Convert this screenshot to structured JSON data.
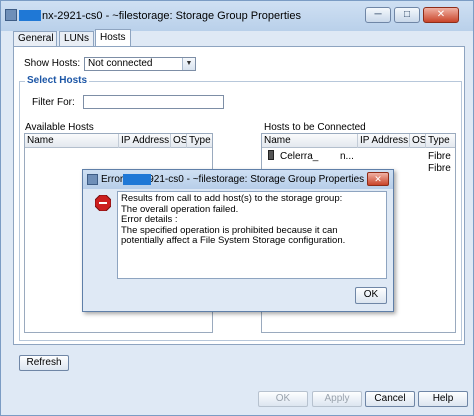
{
  "window": {
    "title": "nx-2921-cs0 - ~filestorage: Storage Group Properties",
    "minimize_glyph": "─",
    "maximize_glyph": "□",
    "close_glyph": "✕"
  },
  "tabs": [
    {
      "label": "General"
    },
    {
      "label": "LUNs"
    },
    {
      "label": "Hosts"
    }
  ],
  "show_hosts": {
    "label": "Show Hosts:",
    "selected": "Not connected"
  },
  "select_hosts": {
    "title": "Select Hosts",
    "filter_label": "Filter For:",
    "filter_value": ""
  },
  "available_hosts": {
    "label": "Available Hosts",
    "columns": [
      "Name",
      "IP Address",
      "OS",
      "Type"
    ],
    "rows": []
  },
  "connected_hosts": {
    "label": "Hosts to be Connected",
    "columns": [
      "Name",
      "IP Address",
      "OS",
      "Type"
    ],
    "rows": [
      {
        "name": "Celerra_",
        "ip": "n...",
        "type": "Fibre"
      },
      {
        "name": "",
        "ip": "",
        "type": "Fibre"
      }
    ]
  },
  "buttons": {
    "refresh": "Refresh",
    "ok": "OK",
    "apply": "Apply",
    "cancel": "Cancel",
    "help": "Help"
  },
  "error_dialog": {
    "title": "Error: nx-2921-cs0 - ~filestorage: Storage Group Properties",
    "lines": [
      "Results from call to add host(s) to the storage group:",
      "The overall operation failed.",
      "",
      "Error details :",
      "The specified operation is prohibited because it can",
      "potentially affect a File System Storage configuration."
    ],
    "ok_label": "OK",
    "close_glyph": "✕"
  },
  "colors": {
    "accent": "#1c56a6",
    "window_bg": "#dfe9f5",
    "error_red": "#cc1f1f"
  }
}
